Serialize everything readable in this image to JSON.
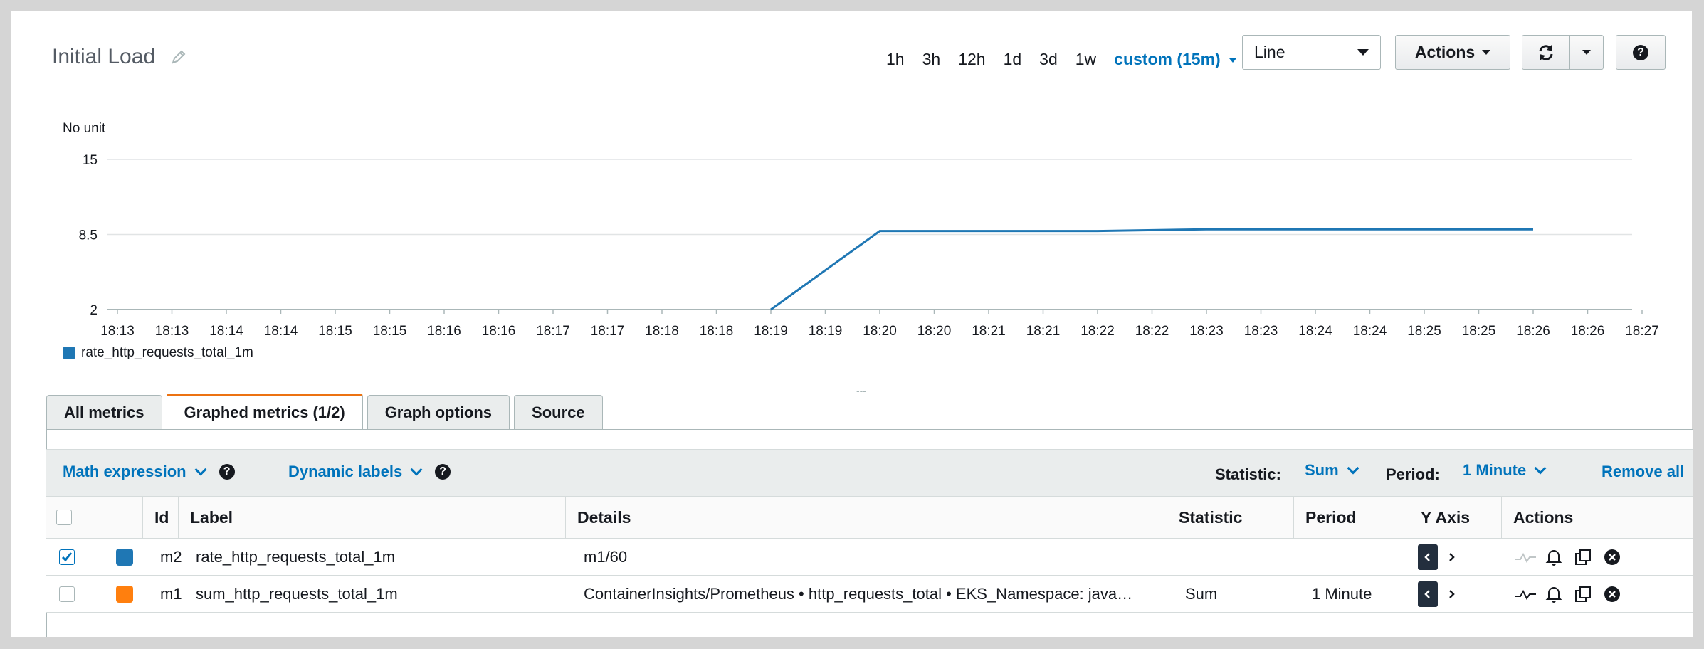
{
  "header": {
    "title": "Initial Load",
    "ranges": [
      "1h",
      "3h",
      "12h",
      "1d",
      "3d",
      "1w"
    ],
    "custom_range": "custom (15m)",
    "chart_type_select": "Line",
    "actions_label": "Actions"
  },
  "chart_data": {
    "type": "line",
    "ylabel": "No unit",
    "yticks": [
      "15",
      "8.5",
      "2"
    ],
    "ylim": [
      2,
      15
    ],
    "xticks": [
      "18:13",
      "18:13",
      "18:14",
      "18:14",
      "18:15",
      "18:15",
      "18:16",
      "18:16",
      "18:17",
      "18:17",
      "18:18",
      "18:18",
      "18:19",
      "18:19",
      "18:20",
      "18:20",
      "18:21",
      "18:21",
      "18:22",
      "18:22",
      "18:23",
      "18:23",
      "18:24",
      "18:24",
      "18:25",
      "18:25",
      "18:26",
      "18:26",
      "18:27"
    ],
    "series": [
      {
        "name": "rate_http_requests_total_1m",
        "color": "#1f77b4",
        "points": [
          {
            "x": "18:19",
            "y": 2
          },
          {
            "x": "18:20",
            "y": 8.8
          },
          {
            "x": "18:21",
            "y": 8.8
          },
          {
            "x": "18:22",
            "y": 8.8
          },
          {
            "x": "18:23",
            "y": 8.95
          },
          {
            "x": "18:24",
            "y": 8.95
          },
          {
            "x": "18:25",
            "y": 8.95
          },
          {
            "x": "18:26",
            "y": 8.95
          }
        ]
      }
    ],
    "grid": true,
    "legend_position": "bottom-left"
  },
  "tabs": [
    {
      "label": "All metrics",
      "active": false
    },
    {
      "label": "Graphed metrics (1/2)",
      "active": true
    },
    {
      "label": "Graph options",
      "active": false
    },
    {
      "label": "Source",
      "active": false
    }
  ],
  "toolbar": {
    "math_expression": "Math expression",
    "dynamic_labels": "Dynamic labels",
    "statistic_label": "Statistic:",
    "statistic_value": "Sum",
    "period_label": "Period:",
    "period_value": "1 Minute",
    "remove_all": "Remove all"
  },
  "table": {
    "headers": {
      "id": "Id",
      "label": "Label",
      "details": "Details",
      "statistic": "Statistic",
      "period": "Period",
      "yaxis": "Y Axis",
      "actions": "Actions"
    },
    "rows": [
      {
        "checked": true,
        "color": "#1f77b4",
        "id": "m2",
        "label": "rate_http_requests_total_1m",
        "details": "m1/60",
        "statistic": "",
        "period": ""
      },
      {
        "checked": false,
        "color": "#ff7f0e",
        "id": "m1",
        "label": "sum_http_requests_total_1m",
        "details": "ContainerInsights/Prometheus • http_requests_total • EKS_Namespace: java…",
        "statistic": "Sum",
        "period": "1 Minute"
      }
    ]
  }
}
